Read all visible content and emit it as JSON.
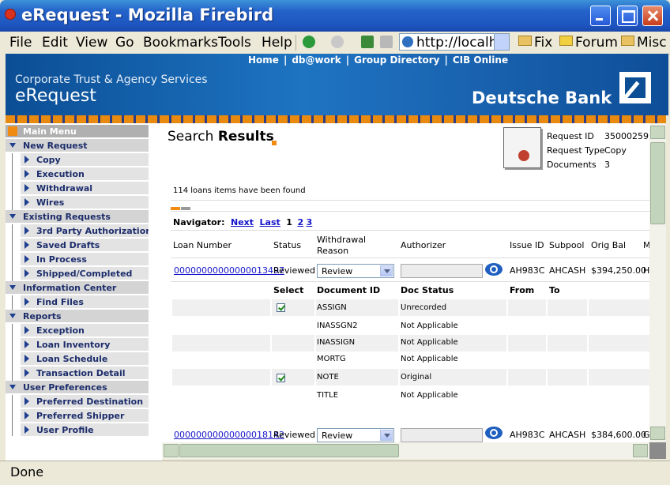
{
  "window": {
    "title": "eRequest - Mozilla Firebird"
  },
  "menubar": {
    "items": [
      "File",
      "Edit",
      "View",
      "Go",
      "Bookmarks",
      "Tools",
      "Help"
    ],
    "url": "http://localhost",
    "bookmarks": [
      "Fix",
      "Forum",
      "Misc"
    ]
  },
  "banner": {
    "links": [
      "Home",
      "db@work",
      "Group Directory",
      "CIB Online"
    ],
    "subtitle": "Corporate Trust & Agency Services",
    "app_title": "eRequest",
    "brand": "Deutsche Bank"
  },
  "sidebar": {
    "main_menu": "Main Menu",
    "sections": [
      {
        "label": "New Request",
        "items": [
          "Copy",
          "Execution",
          "Withdrawal",
          "Wires"
        ]
      },
      {
        "label": "Existing Requests",
        "items": [
          "3rd Party Authorization",
          "Saved Drafts",
          "In Process",
          "Shipped/Completed"
        ]
      },
      {
        "label": "Information Center",
        "items": [
          "Find Files"
        ]
      },
      {
        "label": "Reports",
        "items": [
          "Exception",
          "Loan Inventory",
          "Loan Schedule",
          "Transaction Detail"
        ]
      },
      {
        "label": "User Preferences",
        "items": [
          "Preferred Destination",
          "Preferred Shipper",
          "User Profile"
        ]
      }
    ]
  },
  "content": {
    "heading_light": "Search",
    "heading_bold": "Results",
    "request_info": {
      "id_label": "Request ID",
      "id_value": "35000259",
      "type_label": "Request Type",
      "type_value": "Copy",
      "docs_label": "Documents",
      "docs_value": "3"
    },
    "found_text": "114 loans items have been found",
    "navigator": {
      "label": "Navigator:",
      "next": "Next",
      "last": "Last",
      "pages": [
        "1",
        "2",
        "3"
      ]
    },
    "loan_headers": [
      "Loan Number",
      "Status",
      "Withdrawal Reason",
      "Authorizer",
      "Issue ID",
      "Subpool",
      "Orig Bal",
      "M"
    ],
    "doc_headers": [
      "Select",
      "Document ID",
      "Doc Status",
      "From",
      "To"
    ],
    "loans": [
      {
        "number": "00000000000000013497",
        "status": "Reviewed",
        "reason": "Review",
        "issue_id": "AH983C",
        "subpool": "AHCASH",
        "orig_bal": "$394,250.00",
        "m": "H",
        "documents": [
          {
            "selected": true,
            "id": "ASSIGN",
            "status": "Unrecorded"
          },
          {
            "selected": false,
            "id": "INASSGN2",
            "status": "Not Applicable"
          },
          {
            "selected": false,
            "id": "INASSIGN",
            "status": "Not Applicable"
          },
          {
            "selected": false,
            "id": "MORTG",
            "status": "Not Applicable"
          },
          {
            "selected": true,
            "id": "NOTE",
            "status": "Original"
          },
          {
            "selected": false,
            "id": "TITLE",
            "status": "Not Applicable"
          }
        ]
      },
      {
        "number": "00000000000000018142",
        "status": "Reviewed",
        "reason": "Review",
        "issue_id": "AH983C",
        "subpool": "AHCASH",
        "orig_bal": "$384,600.00",
        "m": "G"
      }
    ]
  },
  "status_bar": {
    "text": "Done"
  }
}
